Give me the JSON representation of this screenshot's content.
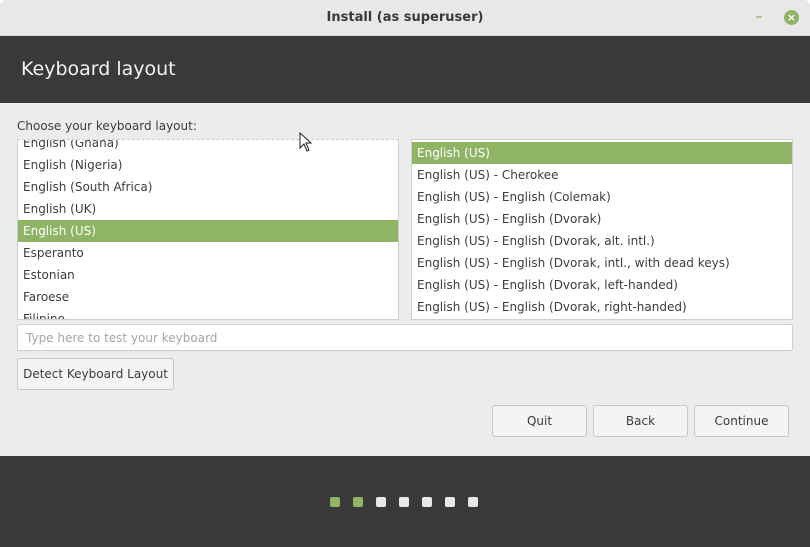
{
  "window": {
    "title": "Install (as superuser)",
    "minimize_glyph": "–",
    "close_glyph": "×"
  },
  "header": {
    "title": "Keyboard layout"
  },
  "prompt": "Choose your keyboard layout:",
  "layouts": {
    "items": [
      "English (Ghana)",
      "English (Nigeria)",
      "English (South Africa)",
      "English (UK)",
      "English (US)",
      "Esperanto",
      "Estonian",
      "Faroese",
      "Filipino"
    ],
    "selected": "English (US)"
  },
  "variants": {
    "items": [
      "English (US)",
      "English (US) - Cherokee",
      "English (US) - English (Colemak)",
      "English (US) - English (Dvorak)",
      "English (US) - English (Dvorak, alt. intl.)",
      "English (US) - English (Dvorak, intl., with dead keys)",
      "English (US) - English (Dvorak, left-handed)",
      "English (US) - English (Dvorak, right-handed)"
    ],
    "selected": "English (US)"
  },
  "test_field": {
    "placeholder": "Type here to test your keyboard",
    "value": ""
  },
  "buttons": {
    "detect": "Detect Keyboard Layout",
    "quit": "Quit",
    "back": "Back",
    "continue": "Continue"
  },
  "progress": {
    "total_steps": 7,
    "completed_steps": 2
  },
  "colors": {
    "accent": "#8fb466",
    "banner": "#393939",
    "background": "#ececec"
  },
  "icons": {
    "minimize": "minimize-icon",
    "close": "close-icon",
    "cursor": "mouse-pointer-icon"
  }
}
